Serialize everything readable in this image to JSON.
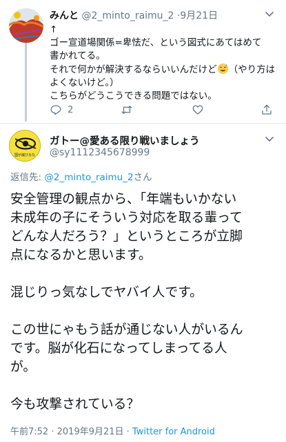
{
  "parent_tweet": {
    "name": "みんと",
    "handle": "@2_minto_raimu_2",
    "separator": "·",
    "date": "9月21日",
    "body_lines": [
      "↑",
      "ゴー宣道場関係=卑怯だ、という図式にあてはめて",
      "書かれてる。",
      "それで何かが解決するならいいんだけど",
      "よくないけど。）",
      "こちらがどうこうできる問題ではない。"
    ],
    "body_line4_suffix": "（やり方は",
    "emoji": "sweat-smile",
    "actions": {
      "reply_count": "2",
      "retweet_count": "",
      "like_count": ""
    }
  },
  "main_tweet": {
    "name": "ガトー@愛ある限り戦いましょう",
    "handle": "@sy1112345678999",
    "reply_prefix": "返信先:",
    "reply_target": "@2_minto_raimu_2",
    "reply_suffix": "さん",
    "avatar_caption": "国が滅びるな",
    "body_lines": [
      "安全管理の観点から、「年端もいかない",
      "未成年の子にそういう対応を取る輩って",
      "どんな人だろう？」というところが立脚",
      "点になるかと思います。",
      "",
      "混じりっ気なしでヤバイ人です。",
      "",
      "この世にゃもう話が通じない人がいるん",
      "です。脳が化石になってしまってる人",
      "が。",
      "",
      "今も攻撃されている？"
    ],
    "time": "午前7:52",
    "date": "2019年9月21日",
    "separator": "·",
    "source": "Twitter for Android"
  },
  "colors": {
    "link": "#1b95e0",
    "secondary_text": "#657786",
    "thread_line": "#c4cfd6"
  }
}
